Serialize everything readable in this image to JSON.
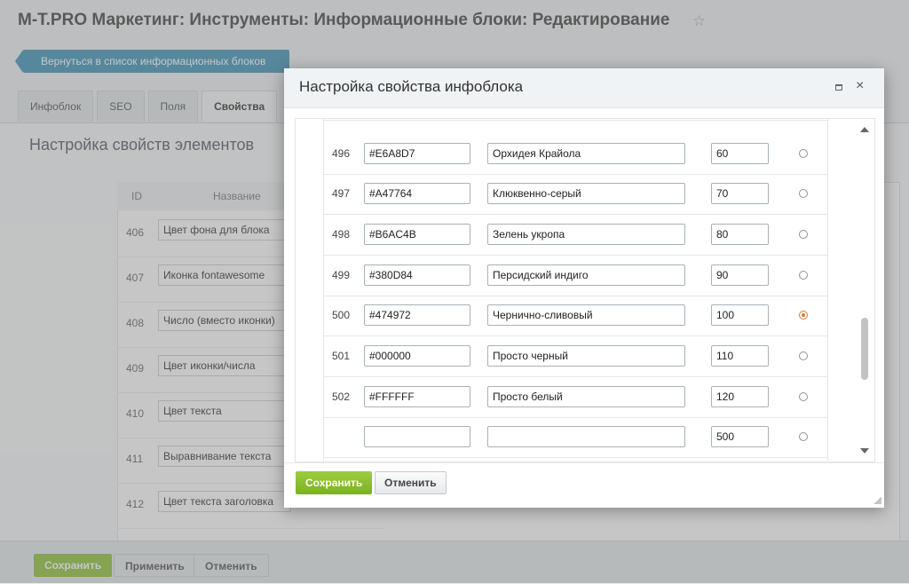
{
  "page": {
    "title": "M-T.PRO Маркетинг: Инструменты: Информационные блоки: Редактирование",
    "back_label": "Вернуться в список информационных блоков",
    "tabs": [
      {
        "label": "Инфоблок"
      },
      {
        "label": "SEO"
      },
      {
        "label": "Поля"
      },
      {
        "label": "Свойства"
      }
    ],
    "section_title": "Настройка свойств элементов",
    "table_headers": {
      "id": "ID",
      "name": "Название"
    },
    "rows": [
      {
        "id": "406",
        "name": "Цвет фона для блока"
      },
      {
        "id": "407",
        "name": "Иконка fontawesome"
      },
      {
        "id": "408",
        "name": "Число (вместо иконки)"
      },
      {
        "id": "409",
        "name": "Цвет иконки/числа"
      },
      {
        "id": "410",
        "name": "Цвет текста"
      },
      {
        "id": "411",
        "name": "Выравнивание текста"
      },
      {
        "id": "412",
        "name": "Цвет текста заголовка"
      }
    ],
    "bottom_buttons": {
      "save": "Сохранить",
      "apply": "Применить",
      "cancel": "Отменить"
    }
  },
  "dialog": {
    "title": "Настройка свойства инфоблока",
    "rows": [
      {
        "num": "496",
        "code": "#E6A8D7",
        "name": "Орхидея Крайола",
        "sort": "60",
        "selected": false
      },
      {
        "num": "497",
        "code": "#A47764",
        "name": "Клюквенно-серый",
        "sort": "70",
        "selected": false
      },
      {
        "num": "498",
        "code": "#B6AC4B",
        "name": "Зелень укропа",
        "sort": "80",
        "selected": false
      },
      {
        "num": "499",
        "code": "#380D84",
        "name": "Персидский индиго",
        "sort": "90",
        "selected": false
      },
      {
        "num": "500",
        "code": "#474972",
        "name": "Чернично-сливовый",
        "sort": "100",
        "selected": true
      },
      {
        "num": "501",
        "code": "#000000",
        "name": "Просто черный",
        "sort": "110",
        "selected": false
      },
      {
        "num": "502",
        "code": "#FFFFFF",
        "name": "Просто белый",
        "sort": "120",
        "selected": false
      },
      {
        "num": "",
        "code": "",
        "name": "",
        "sort": "500",
        "selected": false
      }
    ],
    "buttons": {
      "save": "Сохранить",
      "cancel": "Отменить"
    }
  },
  "colors": {
    "accent_blue": "#3e94b9",
    "save_green": "#8fc33a",
    "radio_selected": "#e07a2b"
  }
}
